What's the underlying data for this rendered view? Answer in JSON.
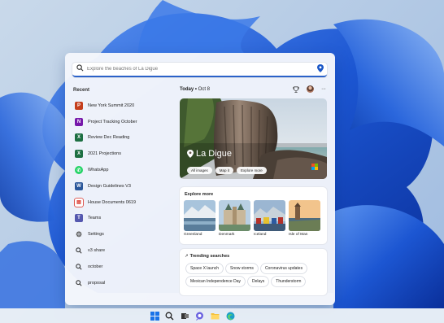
{
  "search": {
    "placeholder": "Explore the beaches of La Digue"
  },
  "recent": {
    "heading": "Recent",
    "items": [
      {
        "label": "New York Summit 2020",
        "icon": "powerpoint-icon",
        "color": "#c43e1c"
      },
      {
        "label": "Project Tracking October",
        "icon": "onenote-icon",
        "color": "#7719aa"
      },
      {
        "label": "Review Dec Reading",
        "icon": "excel-icon",
        "color": "#1d6f42"
      },
      {
        "label": "2021 Projections",
        "icon": "excel-icon",
        "color": "#1d6f42"
      },
      {
        "label": "WhatsApp",
        "icon": "whatsapp-icon",
        "color": "#25d366"
      },
      {
        "label": "Design Guidelines V3",
        "icon": "word-icon",
        "color": "#2b579a"
      },
      {
        "label": "House Documents 0619",
        "icon": "pdf-icon",
        "color": "#d93025"
      },
      {
        "label": "Teams",
        "icon": "teams-icon",
        "color": "#5558af"
      },
      {
        "label": "Settings",
        "icon": "gear-icon",
        "color": "#6b6b6b"
      },
      {
        "label": "v3 share",
        "icon": "search-icon",
        "color": "#444444"
      },
      {
        "label": "october",
        "icon": "search-icon",
        "color": "#444444"
      },
      {
        "label": "proposal",
        "icon": "search-icon",
        "color": "#444444"
      }
    ]
  },
  "today": {
    "label": "Today",
    "sep": " • ",
    "date": "Oct 8"
  },
  "hero": {
    "title": "La Digue",
    "chips": [
      "All images",
      "Map it",
      "Explore more"
    ]
  },
  "explore": {
    "heading": "Explore more",
    "places": [
      "Greenland",
      "Denmark",
      "Iceland",
      "Isle of Man"
    ]
  },
  "trending": {
    "heading": "Trending searches",
    "items": [
      "Space X launch",
      "Snow storms",
      "Coronavirus updates",
      "Mexican Independence Day",
      "Delays",
      "Thunderstorm"
    ]
  },
  "taskbar": {
    "icons": [
      "windows-start-icon",
      "search-icon",
      "task-view-icon",
      "chat-icon",
      "file-explorer-icon",
      "edge-icon"
    ]
  },
  "colors": {
    "accent": "#2b62c9",
    "wallpaper": "#1f5fd6"
  }
}
